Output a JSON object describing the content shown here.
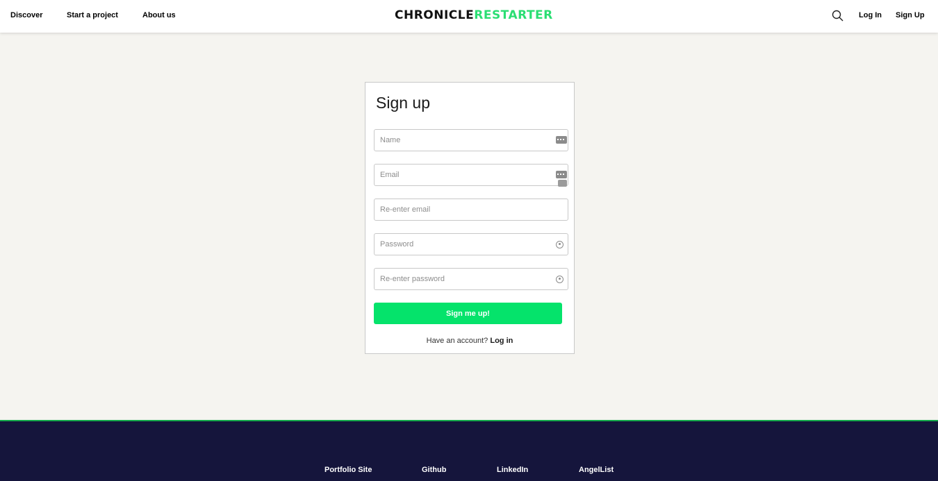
{
  "header": {
    "nav": [
      "Discover",
      "Start a project",
      "About us"
    ],
    "logo_dark": "CHRONICLE",
    "logo_green": "RESTARTER",
    "login": "Log In",
    "signup": "Sign Up"
  },
  "form": {
    "title": "Sign up",
    "name_placeholder": "Name",
    "email_placeholder": "Email",
    "reemail_placeholder": "Re-enter email",
    "password_placeholder": "Password",
    "repassword_placeholder": "Re-enter password",
    "submit": "Sign me up!",
    "have_account": "Have an account?",
    "login_link": "Log in"
  },
  "footer": {
    "links": [
      "Portfolio Site",
      "Github",
      "LinkedIn",
      "AngelList"
    ]
  },
  "colors": {
    "accent_green": "#05e36b",
    "logo_green": "#2bde73",
    "footer_bg": "#15153c",
    "page_bg": "#f5f4f0"
  }
}
